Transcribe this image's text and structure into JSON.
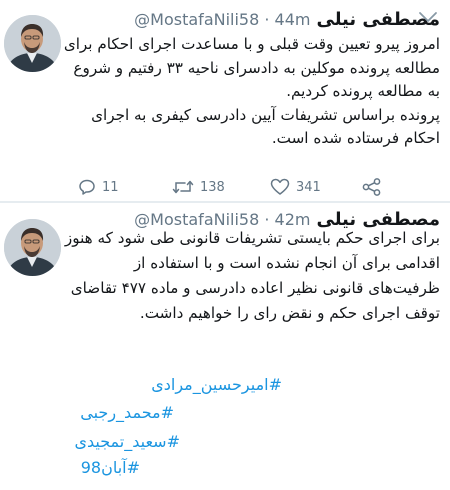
{
  "tweets": [
    {
      "name": "مصطفی نیلی",
      "handle_time": "@MostafaNili58 · 44m",
      "text": [
        "امروز پیرو تعیین وقت قبلی و با مساعدت اجرای احکام برای مطالعه پرونده موکلین به دادسرای ناحیه ۳۳ رفتیم و شروع به مطالعه پرونده کردیم.",
        "پرونده براساس تشریفات آیین دادرسی کیفری به اجرای احکام فرستاده شده است."
      ],
      "actions": {
        "reply_count": "11",
        "retweet_count": "138",
        "like_count": "341"
      }
    },
    {
      "name": "مصطفی نیلی",
      "handle_time": "@MostafaNili58 · 42m",
      "text": [
        "برای اجرای حکم بایستی تشریفات قانونی طی شود که هنوز اقدامی برای آن انجام نشده است و با استفاده از ظرفیت‌های قانونی نظیر اعاده دادرسی و ماده ۴۷۷ تقاضای توقف اجرای حکم و نقض رای را خواهیم داشت."
      ],
      "hashtags": [
        "#امیرحسین_مرادی",
        "#محمد_رجبی",
        "#سعید_تمجیدی",
        "#آبان98"
      ]
    }
  ],
  "icons": {
    "reply": "reply-icon",
    "retweet": "retweet-icon",
    "like": "heart-icon",
    "share": "share-icon",
    "menu": "chevron-down-icon"
  },
  "colors": {
    "text": "#14171a",
    "secondary": "#657786",
    "link": "#1b95e0",
    "divider": "#e6ecf0"
  }
}
